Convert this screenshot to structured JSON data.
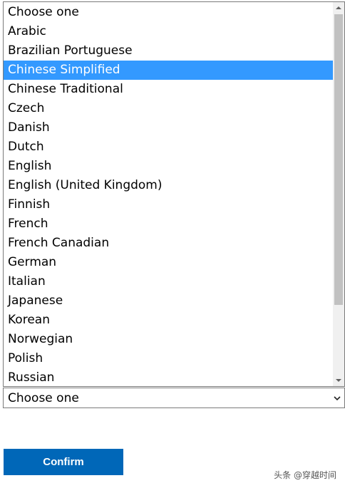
{
  "dropdown": {
    "options": [
      "Choose one",
      "Arabic",
      "Brazilian Portuguese",
      "Chinese Simplified",
      "Chinese Traditional",
      "Czech",
      "Danish",
      "Dutch",
      "English",
      "English (United Kingdom)",
      "Finnish",
      "French",
      "French Canadian",
      "German",
      "Italian",
      "Japanese",
      "Korean",
      "Norwegian",
      "Polish",
      "Russian"
    ],
    "highlighted": "Chinese Simplified",
    "selected_value": "Choose one"
  },
  "confirm_label": "Confirm",
  "watermark": "头条 @穿越时间",
  "colors": {
    "highlight": "#3399ff",
    "button": "#0067b8"
  }
}
